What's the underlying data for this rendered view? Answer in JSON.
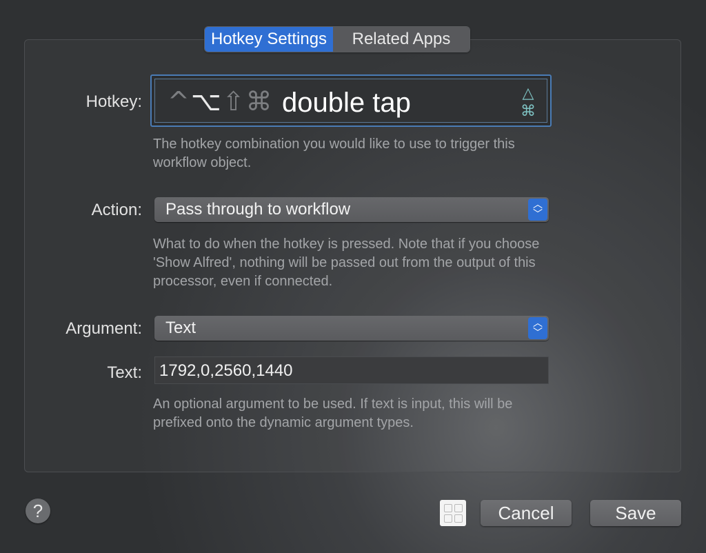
{
  "tabs": [
    {
      "label": "Hotkey Settings",
      "active": true
    },
    {
      "label": "Related Apps",
      "active": false
    }
  ],
  "hotkey": {
    "label": "Hotkey:",
    "modifiers": {
      "control": "^",
      "option": "⌥",
      "shift": "⇧",
      "command": "⌘"
    },
    "value": "double tap",
    "icons": {
      "top": "△",
      "bottom": "⌘"
    },
    "help": "The hotkey combination you would like to use to trigger this workflow object."
  },
  "action": {
    "label": "Action:",
    "selected": "Pass through to workflow",
    "help": "What to do when the hotkey is pressed. Note that if you choose 'Show Alfred', nothing will be passed out from the output of this processor, even if connected."
  },
  "argument": {
    "label": "Argument:",
    "selected": "Text"
  },
  "text": {
    "label": "Text:",
    "value": "1792,0,2560,1440",
    "help": "An optional argument to be used. If text is input, this will be prefixed onto the dynamic argument types."
  },
  "footer": {
    "help": "?",
    "cancel": "Cancel",
    "save": "Save"
  },
  "colors": {
    "accent": "#2f6fd3",
    "hotkey_icon": "#7fc4c4"
  }
}
